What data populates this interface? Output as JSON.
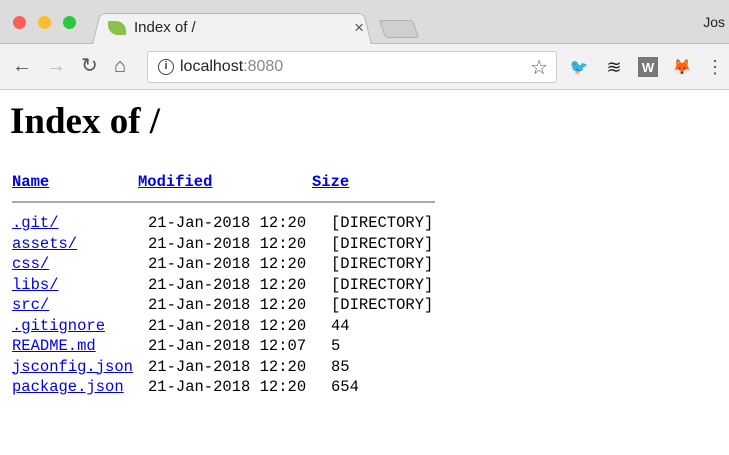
{
  "browser": {
    "tab_title": "Index of /",
    "url_host": "localhost",
    "url_port": ":8080",
    "profile": "Jos",
    "close": "×",
    "extensions": [
      "twitter-icon",
      "buffer-icon",
      "w-icon",
      "metamask-icon"
    ]
  },
  "page": {
    "title": "Index of /",
    "headers": {
      "name": "Name",
      "modified": "Modified",
      "size": "Size"
    },
    "rows": [
      {
        "name": ".git/",
        "modified": "21-Jan-2018 12:20",
        "size": "[DIRECTORY]"
      },
      {
        "name": "assets/",
        "modified": "21-Jan-2018 12:20",
        "size": "[DIRECTORY]"
      },
      {
        "name": "css/",
        "modified": "21-Jan-2018 12:20",
        "size": "[DIRECTORY]"
      },
      {
        "name": "libs/",
        "modified": "21-Jan-2018 12:20",
        "size": "[DIRECTORY]"
      },
      {
        "name": "src/",
        "modified": "21-Jan-2018 12:20",
        "size": "[DIRECTORY]"
      },
      {
        "name": ".gitignore",
        "modified": "21-Jan-2018 12:20",
        "size": "44"
      },
      {
        "name": "README.md",
        "modified": "21-Jan-2018 12:07",
        "size": "5"
      },
      {
        "name": "jsconfig.json",
        "modified": "21-Jan-2018 12:20",
        "size": "85"
      },
      {
        "name": "package.json",
        "modified": "21-Jan-2018 12:20",
        "size": "654"
      }
    ]
  }
}
